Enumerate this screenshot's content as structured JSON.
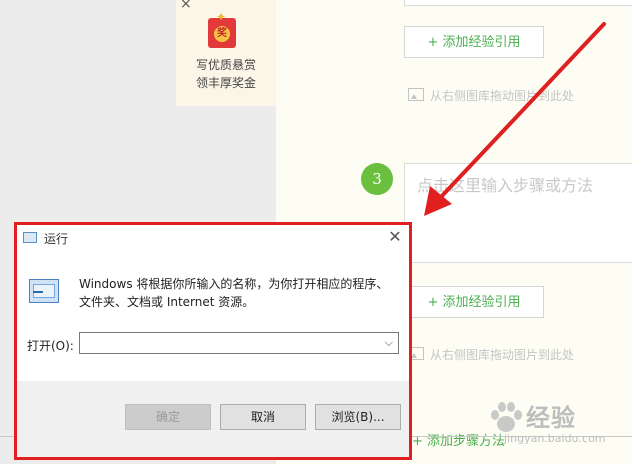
{
  "promo": {
    "badge": "奖",
    "line1": "写优质悬赏",
    "line2": "领丰厚奖金"
  },
  "editor": {
    "add_experience_label": "+ 添加经验引用",
    "drag_hint": "从右侧图库拖动图片到此处",
    "step_number": "3",
    "step_placeholder": "点击这里输入步骤或方法",
    "add_step_label": "+ 添加步骤方法"
  },
  "run_dialog": {
    "title": "运行",
    "description_line1": "Windows 将根据你所输入的名称，为你打开相应的程序、",
    "description_line2": "文件夹、文档或 Internet 资源。",
    "open_label": "打开(O):",
    "open_value": "",
    "ok_label": "确定",
    "cancel_label": "取消",
    "browse_label": "浏览(B)..."
  },
  "watermark": {
    "text": "经验",
    "url": "jingyan.baidu.com"
  },
  "colors": {
    "accent_green": "#4caf50",
    "highlight_red": "#e02020"
  }
}
